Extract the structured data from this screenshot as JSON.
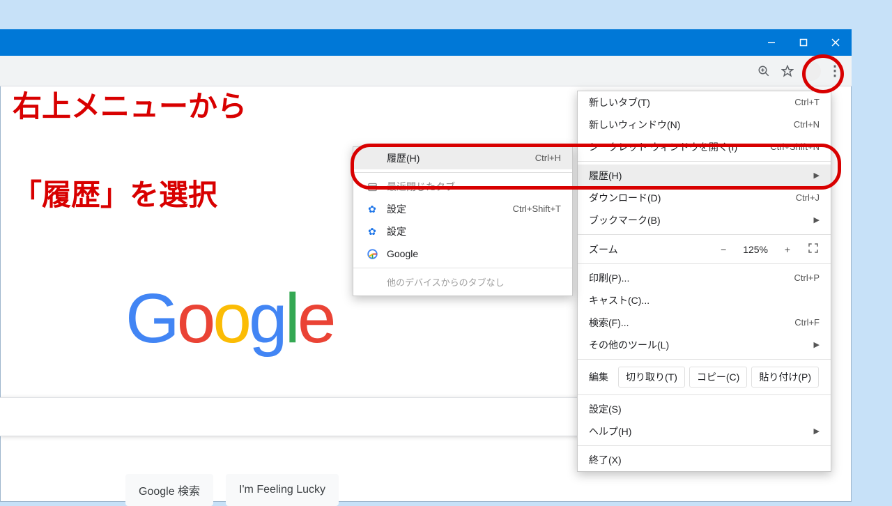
{
  "annotation": {
    "line1": "右上メニューから",
    "line2": "「履歴」を選択"
  },
  "titlebar": {
    "min": "—",
    "max": "□",
    "close": "✕"
  },
  "toolbar": {
    "zoom_icon": "⊕",
    "star_icon": "☆",
    "more_icon": "⋮"
  },
  "page": {
    "logo": "Google",
    "search_btn": "Google 検索",
    "lucky_btn": "I'm Feeling Lucky"
  },
  "menu": {
    "new_tab": {
      "label": "新しいタブ(T)",
      "shortcut": "Ctrl+T"
    },
    "new_window": {
      "label": "新しいウィンドウ(N)",
      "shortcut": "Ctrl+N"
    },
    "incognito": {
      "label": "シークレット ウィンドウを開く(I)",
      "shortcut": "Ctrl+Shift+N"
    },
    "history": {
      "label": "履歴(H)"
    },
    "downloads": {
      "label": "ダウンロード(D)",
      "shortcut": "Ctrl+J"
    },
    "bookmarks": {
      "label": "ブックマーク(B)"
    },
    "zoom_label": "ズーム",
    "zoom_value": "125%",
    "print": {
      "label": "印刷(P)...",
      "shortcut": "Ctrl+P"
    },
    "cast": {
      "label": "キャスト(C)..."
    },
    "find": {
      "label": "検索(F)...",
      "shortcut": "Ctrl+F"
    },
    "more_tools": {
      "label": "その他のツール(L)"
    },
    "edit_label": "編集",
    "cut": "切り取り(T)",
    "copy": "コピー(C)",
    "paste": "貼り付け(P)",
    "settings": {
      "label": "設定(S)"
    },
    "help": {
      "label": "ヘルプ(H)"
    },
    "exit": {
      "label": "終了(X)"
    }
  },
  "submenu": {
    "history": {
      "label": "履歴(H)",
      "shortcut": "Ctrl+H"
    },
    "recent_tabs": "最近閉じたタブ",
    "settings": {
      "label": "設定",
      "shortcut": "Ctrl+Shift+T"
    },
    "settings2": "設定",
    "google": "Google",
    "no_tabs": "他のデバイスからのタブなし"
  }
}
